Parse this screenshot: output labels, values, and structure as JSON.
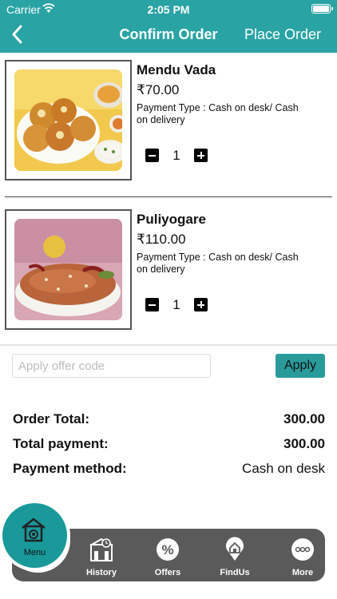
{
  "status_bar": {
    "carrier": "Carrier",
    "time": "2:05 PM"
  },
  "header": {
    "title": "Confirm Order",
    "action": "Place Order"
  },
  "items": [
    {
      "name": "Mendu Vada",
      "price": "₹70.00",
      "payment_type": "Payment Type : Cash on desk/ Cash on delivery",
      "quantity": "1"
    },
    {
      "name": "Puliyogare",
      "price": "₹110.00",
      "payment_type": "Payment Type : Cash on desk/ Cash on delivery",
      "quantity": "1"
    }
  ],
  "offer": {
    "placeholder": "Apply offer code",
    "value": "",
    "apply_label": "Apply"
  },
  "summary": {
    "order_total_label": "Order Total:",
    "order_total": "300.00",
    "total_payment_label": "Total payment:",
    "total_payment": "300.00",
    "payment_method_label": "Payment method:",
    "payment_method": "Cash on desk"
  },
  "nav": {
    "menu": "Menu",
    "tabs": [
      "History",
      "Offers",
      "FindUs",
      "More"
    ]
  },
  "colors": {
    "accent": "#29a3a3",
    "tabbar": "#5a5a5a",
    "menu_button": "#19999a"
  },
  "icons": [
    "back-chevron-icon",
    "wifi-icon",
    "battery-icon",
    "minus-icon",
    "plus-icon",
    "menu-house-icon",
    "history-icon",
    "offers-icon",
    "findus-icon",
    "more-icon"
  ]
}
